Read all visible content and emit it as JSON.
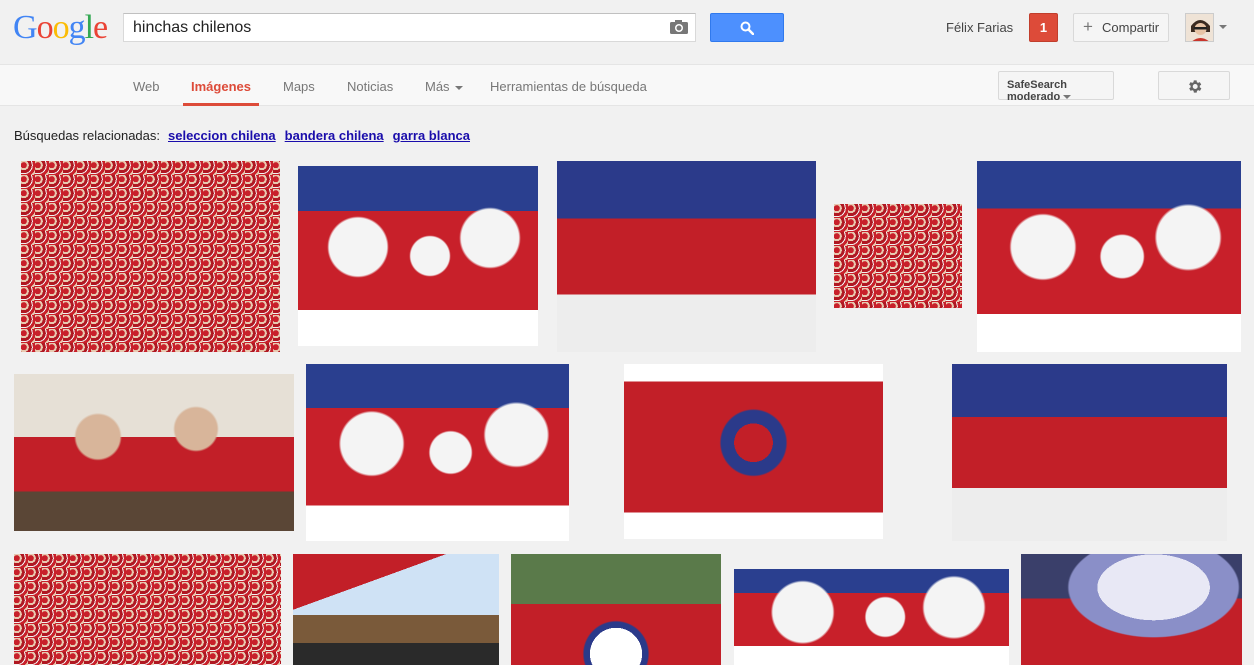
{
  "header": {
    "search_value": "hinchas chilenos",
    "user_name": "Félix Farias",
    "notification_count": "1",
    "share_label": "Compartir",
    "brand_colors": [
      "#4285f4",
      "#ea4335",
      "#fbbc05",
      "#4285f4",
      "#34a853",
      "#ea4335"
    ]
  },
  "nav": {
    "tabs": [
      {
        "label": "Web"
      },
      {
        "label": "Imágenes"
      },
      {
        "label": "Maps"
      },
      {
        "label": "Noticias"
      },
      {
        "label": "Más"
      },
      {
        "label": "Herramientas de búsqueda"
      }
    ],
    "safesearch_label": "SafeSearch moderado"
  },
  "related": {
    "label": "Búsquedas relacionadas:",
    "links": [
      "seleccion chilena",
      "bandera chilena",
      "garra blanca"
    ]
  },
  "results": {
    "thumbnails": [
      {
        "scene": "crowd"
      },
      {
        "scene": "faces"
      },
      {
        "scene": "flags"
      },
      {
        "scene": "crowd"
      },
      {
        "scene": "faces"
      },
      {
        "scene": "people"
      },
      {
        "scene": "faces"
      },
      {
        "scene": "white"
      },
      {
        "scene": "flags"
      },
      {
        "scene": "crowd"
      },
      {
        "scene": "sky"
      },
      {
        "scene": "trees"
      },
      {
        "scene": "faces"
      },
      {
        "scene": "smoke"
      }
    ]
  }
}
